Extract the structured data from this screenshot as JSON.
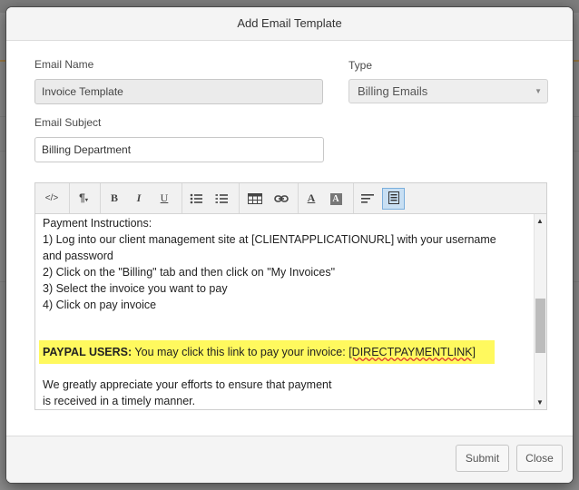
{
  "dialog": {
    "title": "Add Email Template"
  },
  "form": {
    "email_name_label": "Email Name",
    "email_name_value": "Invoice Template",
    "type_label": "Type",
    "type_value": "Billing Emails",
    "email_subject_label": "Email Subject",
    "email_subject_value": "Billing Department"
  },
  "toolbar": {
    "buttons": [
      {
        "name": "code-view-icon",
        "glyph": "</>"
      },
      {
        "name": "paragraph-icon",
        "glyph": "¶"
      },
      {
        "name": "bold-icon",
        "glyph": "B"
      },
      {
        "name": "italic-icon",
        "glyph": "I"
      },
      {
        "name": "underline-icon",
        "glyph": "U"
      },
      {
        "name": "unordered-list-icon",
        "glyph": "list"
      },
      {
        "name": "ordered-list-icon",
        "glyph": "list"
      },
      {
        "name": "table-icon",
        "glyph": "table"
      },
      {
        "name": "link-icon",
        "glyph": "link"
      },
      {
        "name": "font-color-icon",
        "glyph": "A"
      },
      {
        "name": "background-color-icon",
        "glyph": "A"
      },
      {
        "name": "align-icon",
        "glyph": "align"
      },
      {
        "name": "fullscreen-icon",
        "glyph": "doc"
      }
    ]
  },
  "editor": {
    "lines": [
      "Payment Instructions:",
      "1) Log into our client management site at [CLIENTAPPLICATIONURL] with your username",
      "and password",
      "2) Click on the \"Billing\" tab and then click on \"My Invoices\"",
      "3) Select the invoice you want to pay",
      "4) Click on pay invoice"
    ],
    "paypal_label": "PAYPAL USERS:",
    "paypal_text": " You may click this link to pay your invoice: ",
    "paypal_link": "[DIRECTPAYMENTLINK]",
    "closing_line_1": "We greatly appreciate your efforts to ensure that payment",
    "closing_line_2": "is received in a timely manner."
  },
  "footer": {
    "submit_label": "Submit",
    "close_label": "Close"
  },
  "colors": {
    "highlight": "#fff95e",
    "active_button": "#c8dff3"
  }
}
